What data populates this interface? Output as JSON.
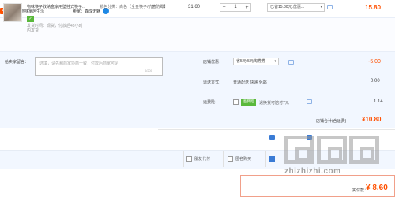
{
  "shop": {
    "name": "店铺：物味家居生活",
    "seller_label": "卖家：森成无魅"
  },
  "item": {
    "title": "物味筷子收纳盒家用壁挂式筷子...",
    "color": "颜色分类：白色【全金筷子/抗菌防霉】",
    "shipping_line1": "发货时间：现货，付款后48小时",
    "shipping_line2": "内发货",
    "unit_price": "31.60",
    "quantity": "1",
    "qty_minus": "−",
    "qty_plus": "+",
    "promo": "已省15.80元:优惠...",
    "total": "15.80"
  },
  "message": {
    "label": "给卖家留言：",
    "placeholder": "选填，请先和商家协商一致，付款后商家可见",
    "count": "0/200"
  },
  "shop_promo": {
    "label": "店铺优惠：",
    "select": "省5元:5元淘券券",
    "value": "-5.00"
  },
  "shipping": {
    "label": "运送方式：",
    "method": "普通配送 快递 免邮",
    "fee": "0.00"
  },
  "insurance": {
    "label": "运费险：",
    "badge": "运费险",
    "text": "退换货可赔付7元",
    "value": "1.14"
  },
  "subtotal": {
    "label": "店铺合计(含运费)",
    "value": "¥10.80"
  },
  "options": {
    "friend_pay": "朋友代付",
    "anonymous": "匿名购买"
  },
  "payment": {
    "label": "实付款：",
    "value": "¥ 8.60"
  },
  "watermark": {
    "text": "zhizhizhi.com"
  },
  "colors": {
    "accent": "#ff5000",
    "badge_green": "#5ab83b",
    "panel_bg": "#f2f7ff",
    "check_blue": "#3a7bd5"
  }
}
